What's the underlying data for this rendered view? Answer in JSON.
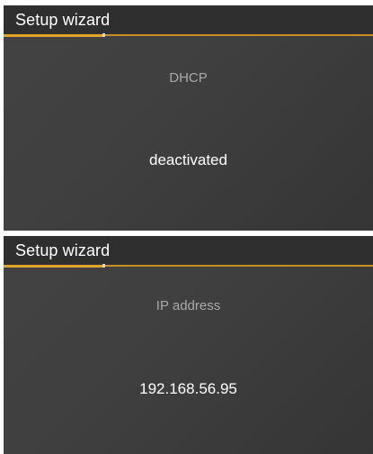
{
  "screens": [
    {
      "title": "Setup wizard",
      "caption": "DHCP",
      "value": "deactivated",
      "progress": 0.27
    },
    {
      "title": "Setup wizard",
      "caption": "IP address",
      "value": "192.168.56.95",
      "progress": 0.27
    }
  ],
  "colors": {
    "accent": "#e3a42c",
    "background": "#404040",
    "title_bar": "#2f2f2f",
    "caption_text": "#a9a9a9",
    "value_text": "#ffffff"
  }
}
